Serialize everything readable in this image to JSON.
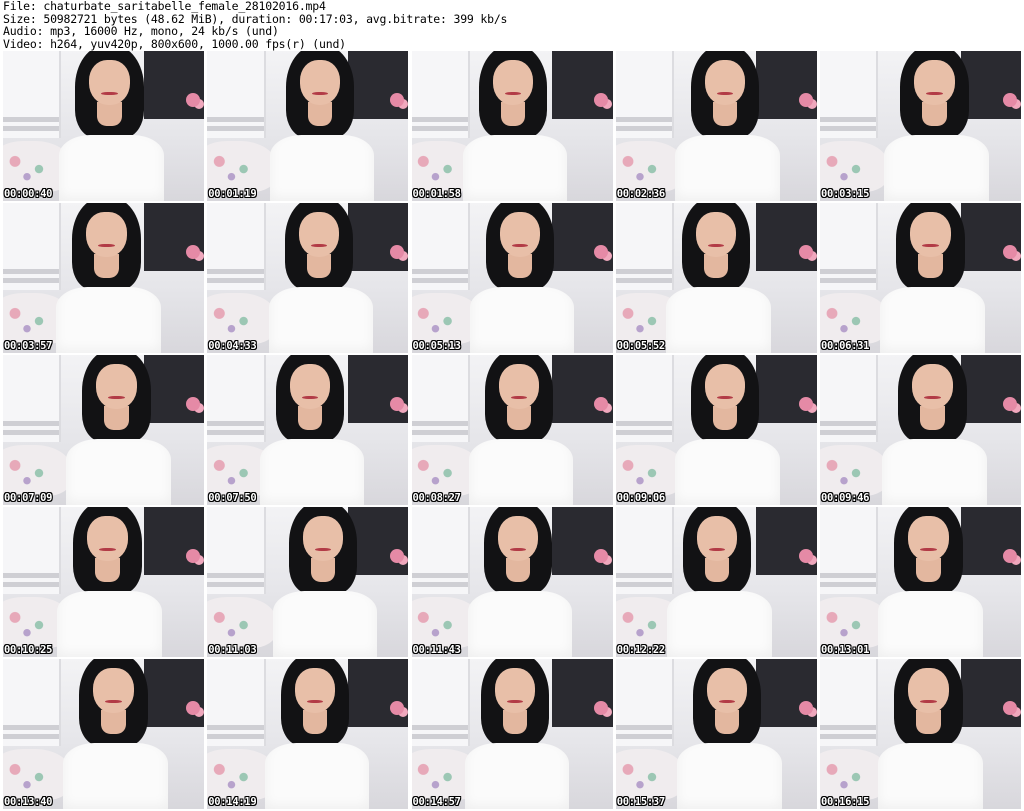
{
  "header": {
    "file_line": "File: chaturbate_saritabelle_female_28102016.mp4",
    "size_line": "Size: 50982721 bytes (48.62 MiB), duration: 00:17:03, avg.bitrate: 399 kb/s",
    "audio_line": "Audio: mp3, 16000 Hz, mono, 24 kb/s (und)",
    "video_line": "Video: h264, yuv420p, 800x600, 1000.00 fps(r) (und)"
  },
  "thumbnails": [
    {
      "timestamp": "00:00:40"
    },
    {
      "timestamp": "00:01:19"
    },
    {
      "timestamp": "00:01:58"
    },
    {
      "timestamp": "00:02:36"
    },
    {
      "timestamp": "00:03:15"
    },
    {
      "timestamp": "00:03:57"
    },
    {
      "timestamp": "00:04:33"
    },
    {
      "timestamp": "00:05:13"
    },
    {
      "timestamp": "00:05:52"
    },
    {
      "timestamp": "00:06:31"
    },
    {
      "timestamp": "00:07:09"
    },
    {
      "timestamp": "00:07:50"
    },
    {
      "timestamp": "00:08:27"
    },
    {
      "timestamp": "00:09:06"
    },
    {
      "timestamp": "00:09:46"
    },
    {
      "timestamp": "00:10:25"
    },
    {
      "timestamp": "00:11:03"
    },
    {
      "timestamp": "00:11:43"
    },
    {
      "timestamp": "00:12:22"
    },
    {
      "timestamp": "00:13:01"
    },
    {
      "timestamp": "00:13:40"
    },
    {
      "timestamp": "00:14:19"
    },
    {
      "timestamp": "00:14:57"
    },
    {
      "timestamp": "00:15:37"
    },
    {
      "timestamp": "00:16:15"
    }
  ],
  "colors": {
    "background": "#ffffff",
    "header_text": "#000000",
    "timestamp_text": "#ffffff",
    "timestamp_outline": "#000000"
  }
}
